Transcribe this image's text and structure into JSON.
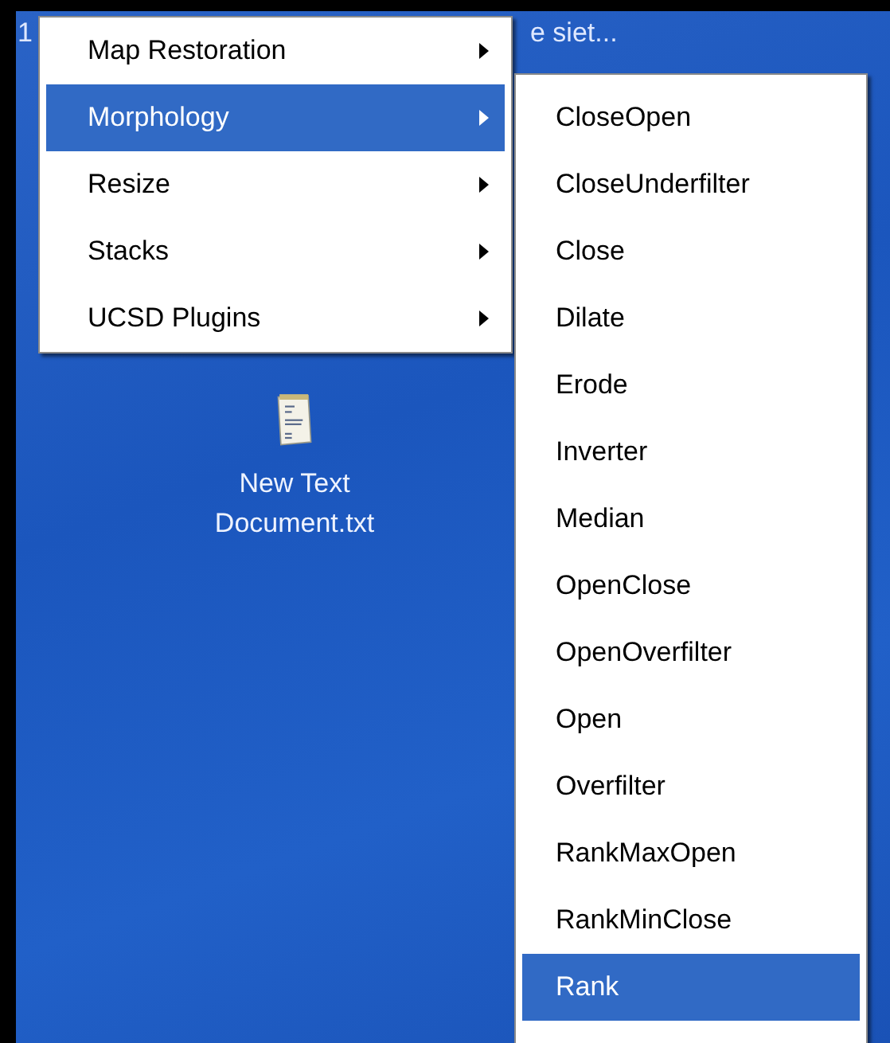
{
  "desktop": {
    "background_texts": [
      "1",
      "e siet..."
    ],
    "icons": [
      {
        "label": "New Text Document.txt"
      }
    ]
  },
  "menu": {
    "items": [
      {
        "label": "Map Restoration",
        "selected": false,
        "has_submenu": true
      },
      {
        "label": "Morphology",
        "selected": true,
        "has_submenu": true
      },
      {
        "label": "Resize",
        "selected": false,
        "has_submenu": true
      },
      {
        "label": "Stacks",
        "selected": false,
        "has_submenu": true
      },
      {
        "label": "UCSD Plugins",
        "selected": false,
        "has_submenu": true
      }
    ]
  },
  "submenu": {
    "items": [
      {
        "label": "CloseOpen",
        "selected": false
      },
      {
        "label": "CloseUnderfilter",
        "selected": false
      },
      {
        "label": "Close",
        "selected": false
      },
      {
        "label": "Dilate",
        "selected": false
      },
      {
        "label": "Erode",
        "selected": false
      },
      {
        "label": "Inverter",
        "selected": false
      },
      {
        "label": "Median",
        "selected": false
      },
      {
        "label": "OpenClose",
        "selected": false
      },
      {
        "label": "OpenOverfilter",
        "selected": false
      },
      {
        "label": "Open",
        "selected": false
      },
      {
        "label": "Overfilter",
        "selected": false
      },
      {
        "label": "RankMaxOpen",
        "selected": false
      },
      {
        "label": "RankMinClose",
        "selected": false
      },
      {
        "label": "Rank",
        "selected": true
      }
    ]
  }
}
